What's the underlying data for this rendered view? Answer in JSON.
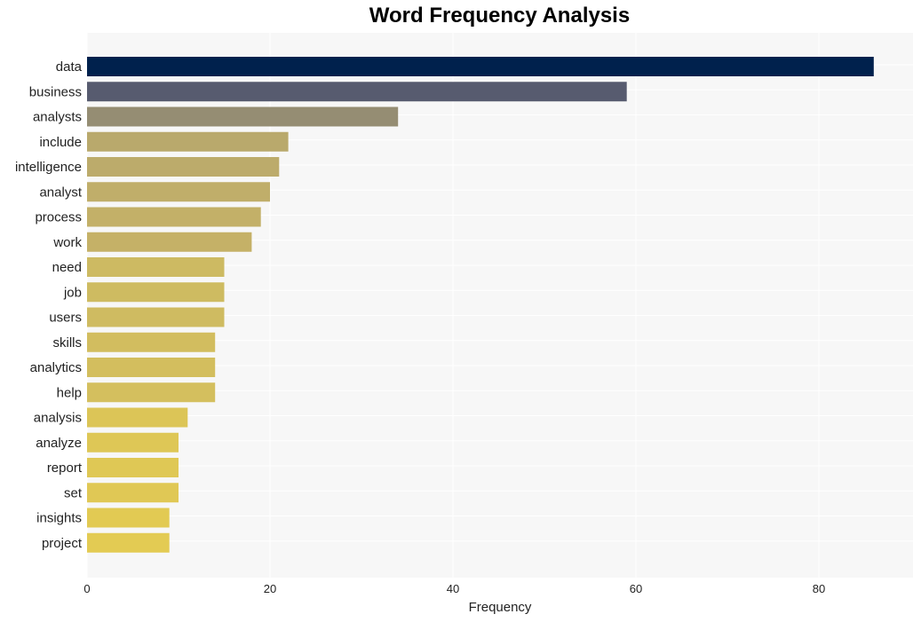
{
  "chart_data": {
    "type": "bar",
    "orientation": "horizontal",
    "title": "Word Frequency Analysis",
    "xlabel": "Frequency",
    "ylabel": "",
    "xlim": [
      0,
      90
    ],
    "xticks": [
      0,
      20,
      40,
      60,
      80
    ],
    "grid": true,
    "legend": "none",
    "categories": [
      "data",
      "business",
      "analysts",
      "include",
      "intelligence",
      "analyst",
      "process",
      "work",
      "need",
      "job",
      "users",
      "skills",
      "analytics",
      "help",
      "analysis",
      "analyze",
      "report",
      "set",
      "insights",
      "project"
    ],
    "values": [
      86,
      59,
      34,
      22,
      21,
      20,
      19,
      18,
      15,
      15,
      15,
      14,
      14,
      14,
      11,
      10,
      10,
      10,
      9,
      9
    ],
    "colors": [
      "#00214d",
      "#575b6f",
      "#958d73",
      "#b9a96c",
      "#bcab6b",
      "#c0ae6a",
      "#c3b068",
      "#c5b167",
      "#cdba62",
      "#cebb61",
      "#cfbb61",
      "#d2bd5f",
      "#d3be5e",
      "#d4bf5e",
      "#dcc557",
      "#dec756",
      "#dfc855",
      "#e0c855",
      "#e2ca53",
      "#e3cb53"
    ]
  }
}
